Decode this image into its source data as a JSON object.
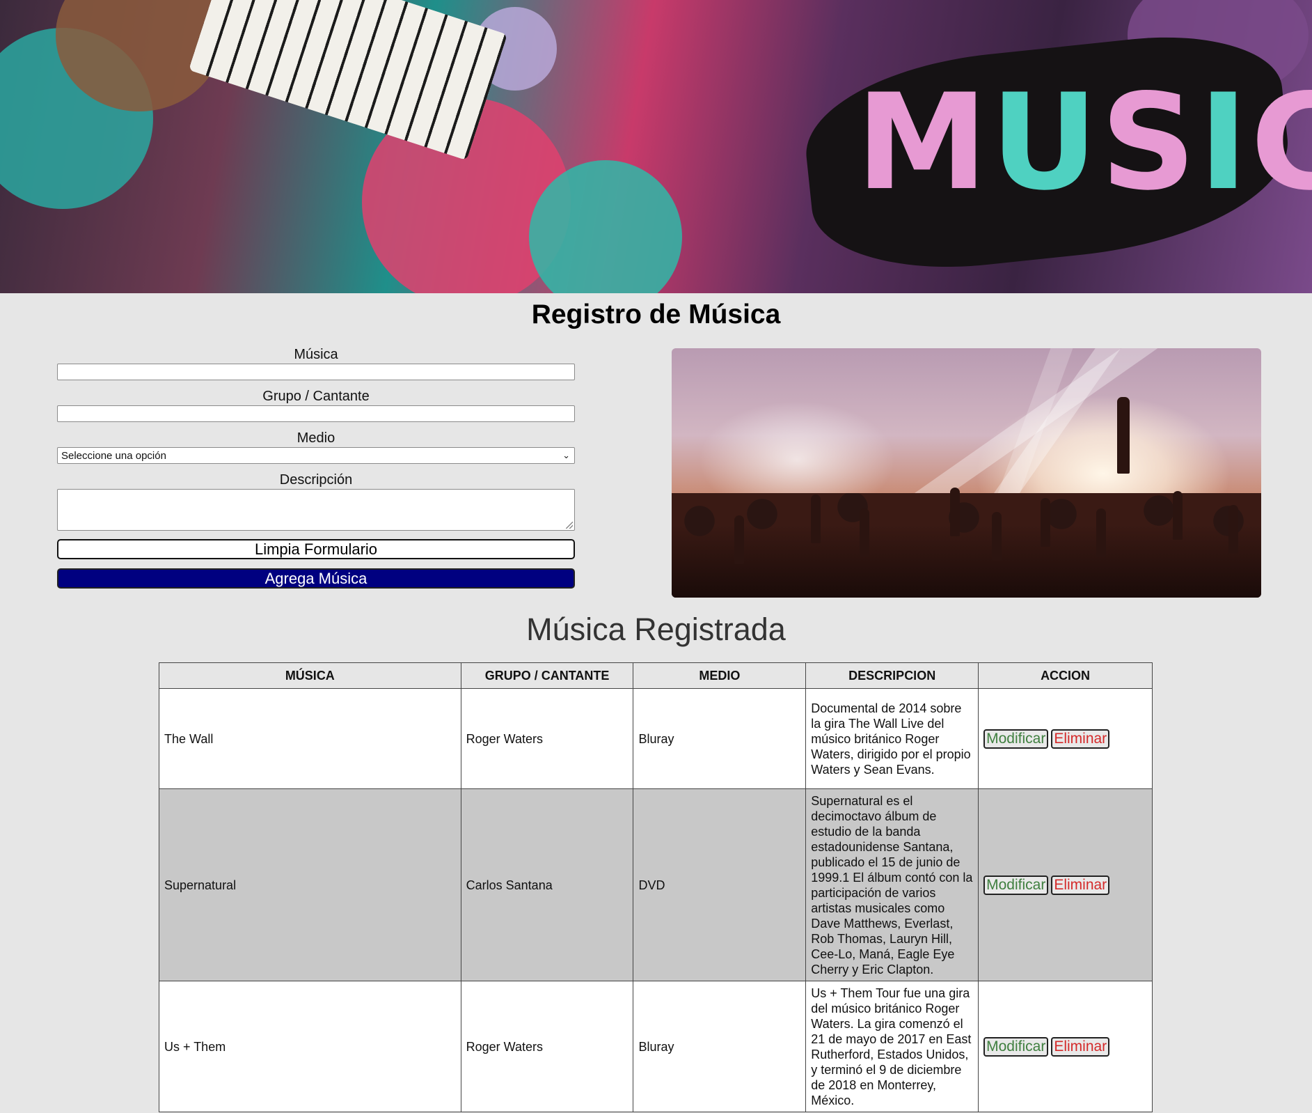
{
  "banner": {
    "word": [
      "M",
      "U",
      "S",
      "I",
      "C"
    ]
  },
  "page_title": "Registro de Música",
  "form": {
    "musica_label": "Música",
    "musica_value": "",
    "grupo_label": "Grupo / Cantante",
    "grupo_value": "",
    "medio_label": "Medio",
    "medio_selected": "Seleccione una opción",
    "descripcion_label": "Descripción",
    "descripcion_value": "",
    "clear_button": "Limpia Formulario",
    "add_button": "Agrega Música"
  },
  "section_title": "Música Registrada",
  "table": {
    "headers": [
      "MÚSICA",
      "GRUPO / CANTANTE",
      "MEDIO",
      "DESCRIPCION",
      "ACCION"
    ],
    "rows": [
      {
        "musica": "The Wall",
        "grupo": "Roger Waters",
        "medio": "Bluray",
        "descripcion": "Documental de 2014 sobre la gira The Wall Live del músico británico Roger Waters, dirigido por el propio Waters y Sean Evans.",
        "modificar": "Modificar",
        "eliminar": "Eliminar"
      },
      {
        "musica": "Supernatural",
        "grupo": "Carlos Santana",
        "medio": "DVD",
        "descripcion": "Supernatural es el decimoctavo álbum de estudio de la banda estadounidense Santana, publicado el 15 de junio de 1999.1 El álbum contó con la participación de varios artistas musicales como Dave Matthews, Everlast, Rob Thomas, Lauryn Hill, Cee-Lo, Maná, Eagle Eye Cherry y Eric Clapton.",
        "modificar": "Modificar",
        "eliminar": "Eliminar"
      },
      {
        "musica": "Us + Them",
        "grupo": "Roger Waters",
        "medio": "Bluray",
        "descripcion": "Us + Them Tour fue una gira del músico británico Roger Waters. La gira comenzó el 21 de mayo de 2017 en East Rutherford, Estados Unidos, y terminó el 9 de diciembre de 2018 en Monterrey, México.",
        "modificar": "Modificar",
        "eliminar": "Eliminar"
      }
    ]
  },
  "colors": {
    "background": "#e6e6e6",
    "add_button_bg": "#000080",
    "modify_text": "#3f7f3f",
    "delete_text": "#d42a2a",
    "row_alt": "#c8c8c8"
  }
}
